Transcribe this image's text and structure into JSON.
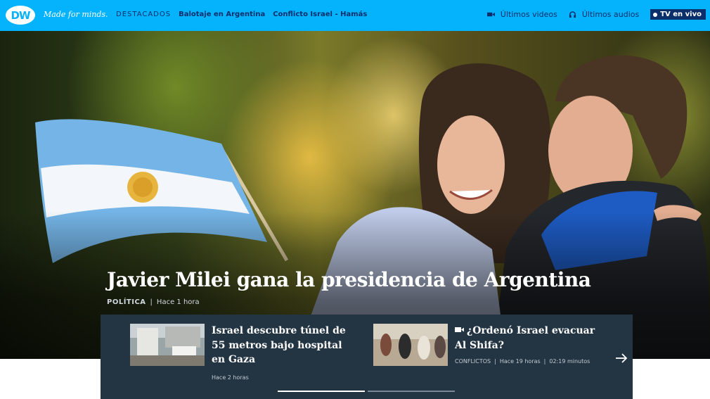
{
  "header": {
    "logo_text": "DW",
    "tagline": "Made for minds.",
    "nav": [
      {
        "label": "DESTACADOS"
      },
      {
        "label": "Balotaje en Argentina"
      },
      {
        "label": "Conflicto Israel - Hamás"
      }
    ],
    "videos_label": "Últimos videos",
    "audios_label": "Últimos audios",
    "live_label": "TV en vivo",
    "icons": {
      "videos": "video-camera-icon",
      "audios": "headphones-icon",
      "live": "live-dot-icon"
    }
  },
  "hero": {
    "title": "Javier Milei gana la presidencia de Argentina",
    "category": "POLÍTICA",
    "separator": "|",
    "time": "Hace 1 hora"
  },
  "teasers": [
    {
      "title": "Israel descubre túnel de 55 metros bajo hospital en Gaza",
      "time": "Hace 2 horas"
    },
    {
      "title": "¿Ordenó Israel evacuar Al Shifa?",
      "category": "CONFLICTOS",
      "separator": "|",
      "time": "Hace 19 horas",
      "duration": "02:19 minutos",
      "icon": "video-camera-icon"
    }
  ],
  "carousel": {
    "next_icon": "arrow-right-icon",
    "progress": [
      1,
      0
    ]
  },
  "colors": {
    "header_bg": "#05b2fc",
    "nav_text": "#0a2f6b",
    "panel_bg": "#233442"
  }
}
